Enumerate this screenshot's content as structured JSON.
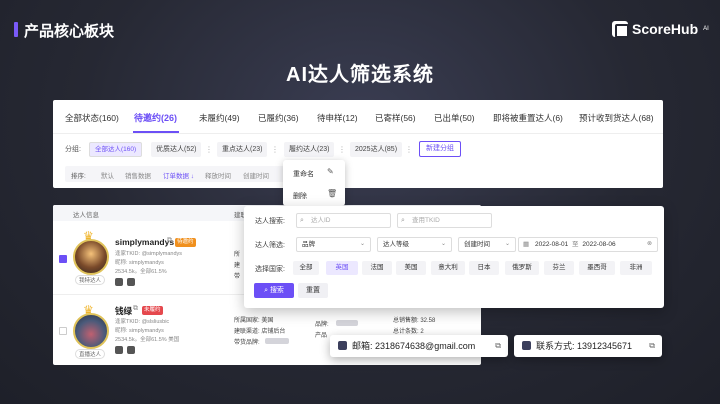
{
  "header": {
    "title": "产品核心板块",
    "logo": "ScoreHub",
    "logo_sup": "AI"
  },
  "main_title": "AI达人筛选系统",
  "tabs": [
    "全部状态(160)",
    "待邀约(26)",
    "未履约(49)",
    "已履约(36)",
    "待申样(12)",
    "已寄样(56)",
    "已出单(50)",
    "即将被重置达人(6)",
    "预计收到货达人(68)"
  ],
  "active_tab": 1,
  "groups": {
    "label": "分组:",
    "chips": [
      "全部达人(160)",
      "优质达人(52)",
      "重点达人(23)",
      "履约达人(23)",
      "2025达人(85)"
    ],
    "new_button": "新建分组"
  },
  "sort": {
    "label": "排序:",
    "items": [
      "默认",
      "销售数据",
      "订单数据 ↓",
      "释放时间",
      "创建时间"
    ]
  },
  "context_menu": {
    "rename": "重命名",
    "delete": "删除"
  },
  "table": {
    "header": {
      "info": "达人信息",
      "col2": "建联"
    },
    "rows": [
      {
        "name": "simplymandys",
        "badge": "待邀约",
        "badge_color": "#f0901e",
        "handle": "逢家TKID: @simplymandys",
        "nick": "昵称: simplymandys",
        "stats": "2534.5k。全部61.5%",
        "avatar_tag": "我特达人",
        "col_labels": [
          "所",
          "建",
          "带"
        ]
      },
      {
        "name": "钱绿",
        "badge": "未履约",
        "badge_color": "#e5484d",
        "handle": "逢家TKID: @slsliusbic",
        "nick": "昵称: simplymandys",
        "stats": "2534.5k。全部61.5%  美国",
        "avatar_tag": "直播达人",
        "country": "所属国家: 美国",
        "channel": "建联渠道: 店铺后台",
        "goods": "带货品牌:",
        "brand": "品牌:",
        "product": "产品",
        "sales": "总销售额: 32.58",
        "orders": "总计条数: 2"
      }
    ]
  },
  "filter": {
    "search_label": "达人搜索:",
    "search_ph1": "达人ID",
    "search_ph2": "查用TKID",
    "filter_label": "达人筛选:",
    "sel_brand": "品牌",
    "sel_level": "达人等级",
    "sel_time": "创建时间",
    "date_from": "2022-08-01",
    "date_to": "2022-08-06",
    "date_sep": "至",
    "country_label": "选择国家:",
    "countries": [
      "全部",
      "英国",
      "法国",
      "美国",
      "意大利",
      "日本",
      "俄罗斯",
      "芬兰",
      "墨西哥",
      "非洲"
    ],
    "active_country": 1,
    "search_btn": "搜索",
    "reset_btn": "重置"
  },
  "contact": {
    "email": "邮箱: 2318674638@gmail.com",
    "phone": "联系方式: 13912345671"
  }
}
